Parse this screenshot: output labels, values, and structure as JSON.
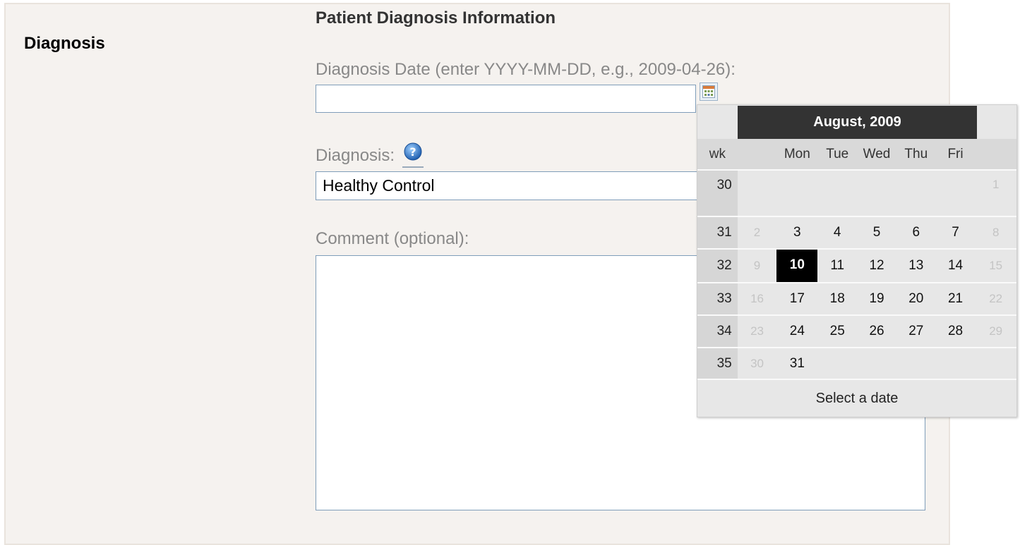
{
  "section": {
    "title": "Diagnosis"
  },
  "form": {
    "title": "Patient Diagnosis Information",
    "date_label": "Diagnosis Date (enter YYYY-MM-DD, e.g., 2009-04-26):",
    "date_value": "",
    "diagnosis_label": "Diagnosis:",
    "diagnosis_value": "Healthy Control",
    "comment_label": "Comment (optional):",
    "comment_value": ""
  },
  "icons": {
    "calendar": "calendar-icon",
    "help": "help-icon"
  },
  "calendar": {
    "title": "August, 2009",
    "headers": [
      "wk",
      "",
      "Mon",
      "Tue",
      "Wed",
      "Thu",
      "Fri",
      ""
    ],
    "weeks": [
      {
        "wk": "30",
        "days": [
          "",
          "",
          "",
          "",
          "",
          "",
          "1"
        ]
      },
      {
        "wk": "31",
        "days": [
          "2",
          "3",
          "4",
          "5",
          "6",
          "7",
          "8"
        ]
      },
      {
        "wk": "32",
        "days": [
          "9",
          "10",
          "11",
          "12",
          "13",
          "14",
          "15"
        ]
      },
      {
        "wk": "33",
        "days": [
          "16",
          "17",
          "18",
          "19",
          "20",
          "21",
          "22"
        ]
      },
      {
        "wk": "34",
        "days": [
          "23",
          "24",
          "25",
          "26",
          "27",
          "28",
          "29"
        ]
      },
      {
        "wk": "35",
        "days": [
          "30",
          "31",
          "",
          "",
          "",
          "",
          ""
        ]
      }
    ],
    "selected_day": "10",
    "footer": "Select a date"
  },
  "colors": {
    "header_bg": "#333333",
    "selected_bg": "#000000",
    "panel_bg": "#f5f2ef"
  }
}
